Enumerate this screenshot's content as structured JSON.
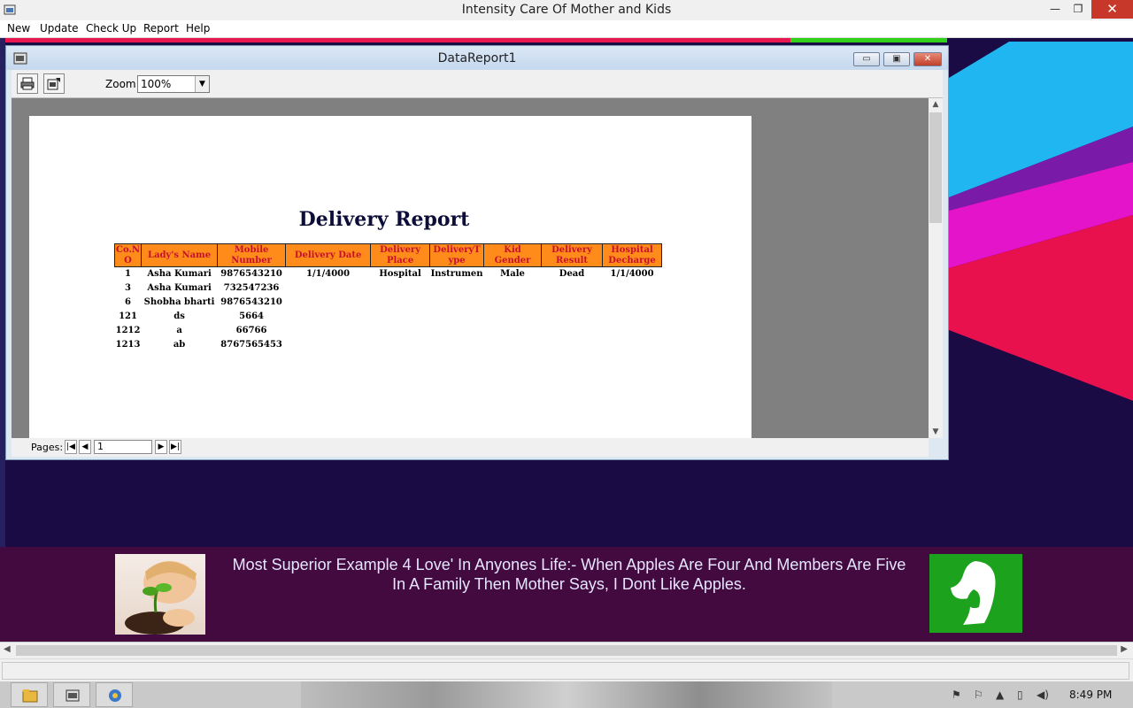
{
  "app": {
    "title": "Intensity Care Of Mother and Kids",
    "min_glyph": "—",
    "max_glyph": "❐",
    "close_glyph": "✕"
  },
  "menu": {
    "items": [
      {
        "label": "New"
      },
      {
        "label": "Update"
      },
      {
        "label": "Check Up"
      },
      {
        "label": "Report"
      },
      {
        "label": "Help"
      }
    ]
  },
  "report_window": {
    "title": "DataReport1",
    "min_glyph": "▭",
    "max_glyph": "▣",
    "close_glyph": "✕",
    "zoom_label": "Zoom",
    "zoom_value": "100%",
    "pages_label": "Pages:",
    "current_page": "1"
  },
  "report": {
    "heading": "Delivery Report",
    "columns": [
      "Co.N O",
      "Lady's Name",
      "Mobile Number",
      "Delivery Date",
      "Delivery Place",
      "DeliveryT ype",
      "Kid Gender",
      "Delivery Result",
      "Hospital Decharge"
    ],
    "rows": [
      [
        "1",
        "Asha Kumari",
        "9876543210",
        "1/1/4000",
        "Hospital",
        "Instrumen",
        "Male",
        "Dead",
        "1/1/4000"
      ],
      [
        "3",
        "Asha Kumari",
        "732547236",
        "",
        "",
        "",
        "",
        "",
        ""
      ],
      [
        "6",
        "Shobha bharti",
        "9876543210",
        "",
        "",
        "",
        "",
        "",
        ""
      ],
      [
        "121",
        "ds",
        "5664",
        "",
        "",
        "",
        "",
        "",
        ""
      ],
      [
        "1212",
        "a",
        "66766",
        "",
        "",
        "",
        "",
        "",
        ""
      ],
      [
        "1213",
        "ab",
        "8767565453",
        "",
        "",
        "",
        "",
        "",
        ""
      ]
    ]
  },
  "banner": {
    "quote": "Most Superior Example 4 Love' In Anyones Life:- When Apples Are Four And Members Are Five In A Family Then Mother Says, I Dont Like Apples."
  },
  "taskbar": {
    "clock": "8:49 PM"
  },
  "colors": {
    "table_header_bg": "#ff8c1a",
    "table_header_text": "#c8102e",
    "banner_bg": "#420a3f",
    "logo_green": "#1ca21c"
  }
}
